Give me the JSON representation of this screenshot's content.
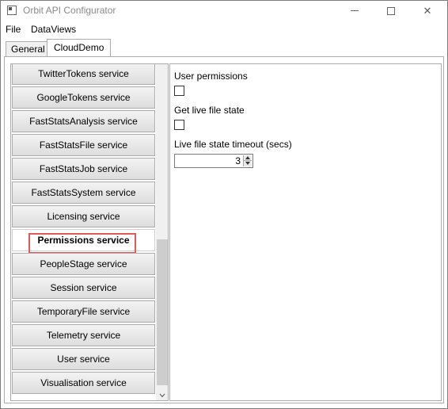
{
  "window": {
    "title": "Orbit API Configurator",
    "minimize_glyph": "—",
    "maximize_glyph": "☐",
    "close_glyph": "✕"
  },
  "menu": {
    "items": [
      {
        "label": "File"
      },
      {
        "label": "DataViews"
      }
    ]
  },
  "tabs": [
    {
      "label": "General",
      "active": false
    },
    {
      "label": "CloudDemo",
      "active": true
    }
  ],
  "services": {
    "items": [
      {
        "label": "TwitterTokens service"
      },
      {
        "label": "GoogleTokens service"
      },
      {
        "label": "FastStatsAnalysis service"
      },
      {
        "label": "FastStatsFile service"
      },
      {
        "label": "FastStatsJob service"
      },
      {
        "label": "FastStatsSystem service"
      },
      {
        "label": "Licensing service"
      },
      {
        "label": "Permissions service",
        "selected": true
      },
      {
        "label": "PeopleStage service"
      },
      {
        "label": "Session service"
      },
      {
        "label": "TemporaryFile service"
      },
      {
        "label": "Telemetry service"
      },
      {
        "label": "User service"
      },
      {
        "label": "Visualisation service"
      }
    ],
    "highlight_color": "#e05a5a"
  },
  "settings": {
    "user_permissions_label": "User permissions",
    "user_permissions_checked": false,
    "live_file_state_label": "Get live file state",
    "live_file_state_checked": false,
    "timeout_label": "Live file state timeout (secs)",
    "timeout_value": "3"
  }
}
